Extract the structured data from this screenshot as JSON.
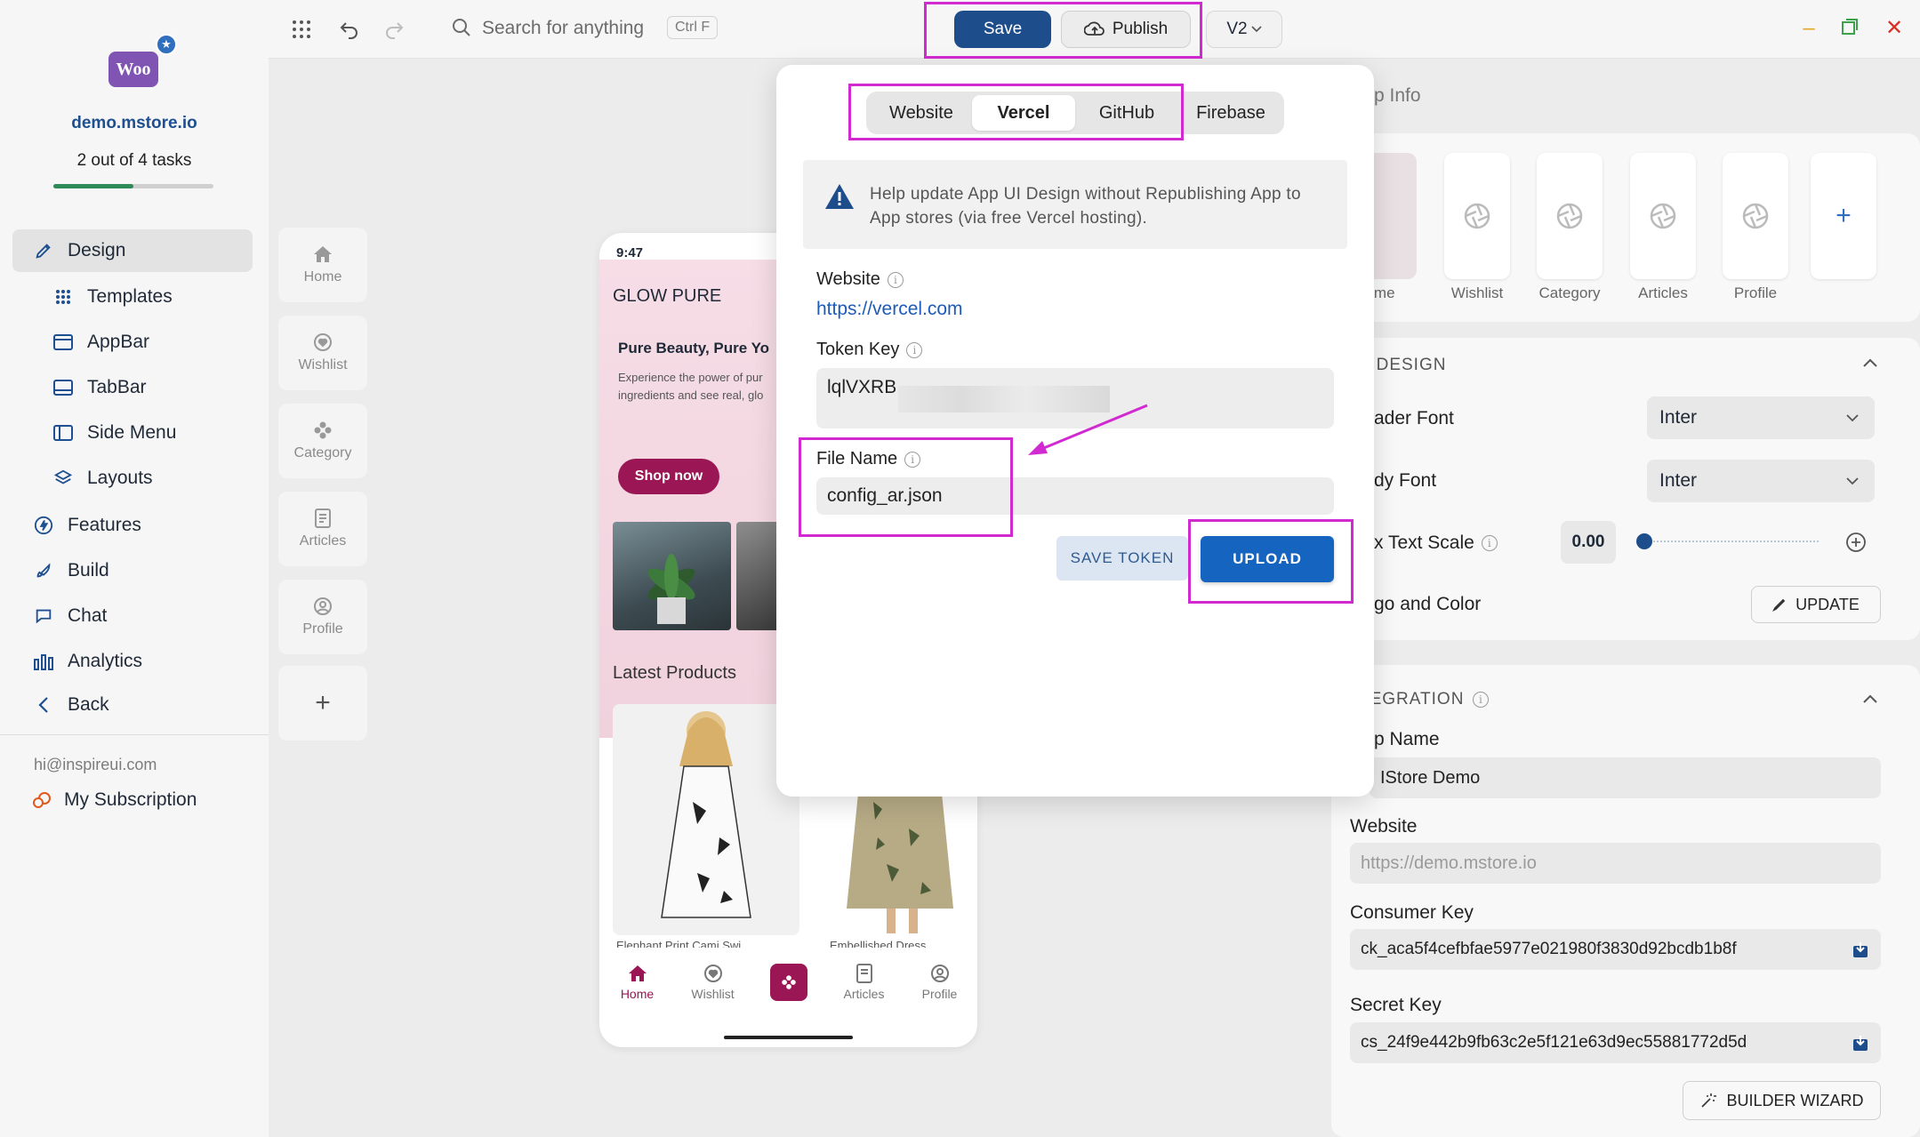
{
  "sidebar": {
    "brand_logo": "Woo",
    "site_url": "demo.mstore.io",
    "tasks_text": "2 out of 4 tasks",
    "tasks_progress": 0.5,
    "items": [
      {
        "label": "Design",
        "icon": "brush-icon",
        "active": true
      },
      {
        "label": "Templates",
        "icon": "grid-dots-icon"
      },
      {
        "label": "AppBar",
        "icon": "appbar-icon"
      },
      {
        "label": "TabBar",
        "icon": "tabbar-icon"
      },
      {
        "label": "Side Menu",
        "icon": "side-menu-icon"
      },
      {
        "label": "Layouts",
        "icon": "layers-icon"
      },
      {
        "label": "Features",
        "icon": "bolt-icon"
      },
      {
        "label": "Build",
        "icon": "rocket-icon"
      },
      {
        "label": "Chat",
        "icon": "chat-icon"
      },
      {
        "label": "Analytics",
        "icon": "bar-chart-icon"
      },
      {
        "label": "Back",
        "icon": "chevron-left-icon"
      }
    ],
    "email": "hi@inspireui.com",
    "subscription": "My Subscription"
  },
  "rail": {
    "items": [
      "Home",
      "Wishlist",
      "Category",
      "Articles",
      "Profile"
    ],
    "add": "+"
  },
  "topbar": {
    "search_placeholder": "Search for anything",
    "shortcut": "Ctrl F",
    "save": "Save",
    "publish": "Publish",
    "version": "V2"
  },
  "phone": {
    "time": "9:47",
    "brand": "GLOW PURE",
    "headline": "Pure Beauty, Pure Yo",
    "body_line1": "Experience the power of pur",
    "body_line2": "ingredients and see real, glo",
    "cta": "Shop now",
    "section_title": "Latest Products",
    "product1": "Elephant Print Cami Swi",
    "product2": "Embellished Dress",
    "nav": [
      "Home",
      "Wishlist",
      "",
      "Articles",
      "Profile"
    ]
  },
  "rightpanel": {
    "header_partial": "p Info",
    "screens": [
      "ome",
      "Wishlist",
      "Category",
      "Articles",
      "Profile"
    ],
    "design_section": "P DESIGN",
    "header_font_label": "ader Font",
    "header_font_value": "Inter",
    "body_font_label": "dy Font",
    "body_font_value": "Inter",
    "text_scale_label": "x Text Scale",
    "text_scale_value": "0.00",
    "logo_color_label": "go and Color",
    "update": "UPDATE",
    "integration_section": "TEGRATION",
    "app_name_label": "p Name",
    "app_name_value": "IStore Demo",
    "website_label": "Website",
    "website_placeholder": "https://demo.mstore.io",
    "consumer_key_label": "Consumer Key",
    "consumer_key_value": "ck_aca5f4cefbfae5977e021980f3830d92bcdb1b8f",
    "secret_key_label": "Secret Key",
    "secret_key_value": "cs_24f9e442b9fb63c2e5f121e63d9ec55881772d5d",
    "builder_wizard": "BUILDER WIZARD"
  },
  "modal": {
    "tabs": [
      "Website",
      "Vercel",
      "GitHub",
      "Firebase"
    ],
    "active_tab": "Vercel",
    "info_line1": "Help update App UI Design without Republishing App to",
    "info_line2": "App stores (via free Vercel hosting).",
    "website_label": "Website",
    "website_link": "https://vercel.com",
    "token_label": "Token Key",
    "token_value": "lqlVXRB",
    "file_label": "File Name",
    "file_value": "config_ar.json",
    "save_token": "SAVE TOKEN",
    "upload": "UPLOAD"
  },
  "colors": {
    "accent": "#1e4d8c",
    "highlight": "#d22ad1",
    "brand_pink": "#9b1654",
    "upload_blue": "#1565c0"
  }
}
